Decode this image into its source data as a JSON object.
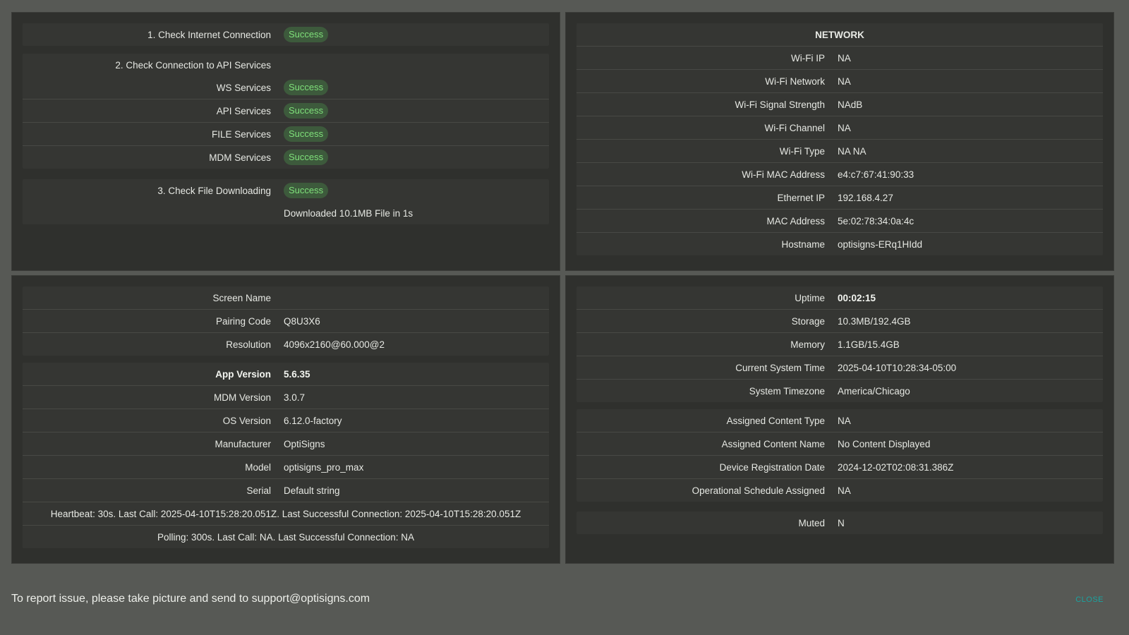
{
  "connection": {
    "internet": {
      "label": "1. Check Internet Connection",
      "status": "Success"
    },
    "api": {
      "label": "2. Check Connection to API Services",
      "services": [
        {
          "label": "WS Services",
          "status": "Success"
        },
        {
          "label": "API Services",
          "status": "Success"
        },
        {
          "label": "FILE Services",
          "status": "Success"
        },
        {
          "label": "MDM Services",
          "status": "Success"
        }
      ]
    },
    "download": {
      "label": "3. Check File Downloading",
      "status": "Success",
      "detail": "Downloaded 10.1MB File in 1s"
    }
  },
  "network": {
    "title": "NETWORK",
    "rows": [
      {
        "label": "Wi-Fi IP",
        "value": "NA"
      },
      {
        "label": "Wi-Fi Network",
        "value": "NA"
      },
      {
        "label": "Wi-Fi Signal Strength",
        "value": "NAdB"
      },
      {
        "label": "Wi-Fi Channel",
        "value": "NA"
      },
      {
        "label": "Wi-Fi Type",
        "value": "NA NA"
      },
      {
        "label": "Wi-Fi MAC Address",
        "value": "e4:c7:67:41:90:33"
      },
      {
        "label": "Ethernet IP",
        "value": "192.168.4.27"
      },
      {
        "label": "MAC Address",
        "value": "5e:02:78:34:0a:4c"
      },
      {
        "label": "Hostname",
        "value": "optisigns-ERq1HIdd"
      }
    ]
  },
  "device": {
    "group1": [
      {
        "label": "Screen Name",
        "value": ""
      },
      {
        "label": "Pairing Code",
        "value": "Q8U3X6"
      },
      {
        "label": "Resolution",
        "value": "4096x2160@60.000@2"
      }
    ],
    "group2": [
      {
        "label": "App Version",
        "value": "5.6.35"
      },
      {
        "label": "MDM Version",
        "value": "3.0.7"
      },
      {
        "label": "OS Version",
        "value": "6.12.0-factory"
      },
      {
        "label": "Manufacturer",
        "value": "OptiSigns"
      },
      {
        "label": "Model",
        "value": "optisigns_pro_max"
      },
      {
        "label": "Serial",
        "value": "Default string"
      }
    ],
    "heartbeat": "Heartbeat: 30s. Last Call: 2025-04-10T15:28:20.051Z. Last Successful Connection: 2025-04-10T15:28:20.051Z",
    "polling": "Polling: 300s. Last Call: NA. Last Successful Connection: NA"
  },
  "system": {
    "group1": [
      {
        "label": "Uptime",
        "value": "00:02:15"
      },
      {
        "label": "Storage",
        "value": "10.3MB/192.4GB"
      },
      {
        "label": "Memory",
        "value": "1.1GB/15.4GB"
      },
      {
        "label": "Current System Time",
        "value": "2025-04-10T10:28:34-05:00"
      },
      {
        "label": "System Timezone",
        "value": "America/Chicago"
      }
    ],
    "group2": [
      {
        "label": "Assigned Content Type",
        "value": "NA"
      },
      {
        "label": "Assigned Content Name",
        "value": "No Content Displayed"
      },
      {
        "label": "Device Registration Date",
        "value": "2024-12-02T02:08:31.386Z"
      },
      {
        "label": "Operational Schedule Assigned",
        "value": "NA"
      }
    ],
    "group3": [
      {
        "label": "Muted",
        "value": "N"
      }
    ]
  },
  "footer": {
    "report_text": "To report issue, please take picture and send to support@optisigns.com",
    "close_label": "CLOSE"
  },
  "colors": {
    "background": "#575955",
    "panel": "#2f302d",
    "success_text": "#7fe07a",
    "success_bg": "#3d5a3c",
    "close": "#1aa3a0"
  }
}
